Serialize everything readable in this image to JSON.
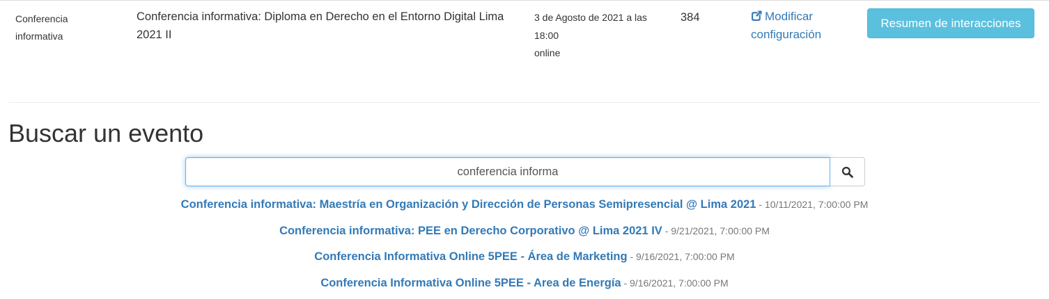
{
  "event_row": {
    "type": "Conferencia informativa",
    "name": "Conferencia informativa: Diploma en Derecho en el Entorno Digital Lima 2021 II",
    "date_line": "3 de Agosto de 2021 a las 18:00",
    "modality": "online",
    "count": "384",
    "config_link": "Modificar configuración",
    "summary_button": "Resumen de interacciones"
  },
  "search": {
    "title": "Buscar un evento",
    "query": "conferencia informa"
  },
  "results": [
    {
      "name": "Conferencia informativa: Maestría en Organización y Dirección de Personas Semipresencial @ Lima 2021",
      "date": " - 10/11/2021, 7:00:00 PM"
    },
    {
      "name": "Conferencia informativa: PEE en Derecho Corporativo @ Lima 2021 IV",
      "date": " - 9/21/2021, 7:00:00 PM"
    },
    {
      "name": "Conferencia Informativa Online 5PEE - Área de Marketing",
      "date": " - 9/16/2021, 7:00:00 PM"
    },
    {
      "name": "Conferencia Informativa Online 5PEE - Area de Energía",
      "date": " - 9/16/2021, 7:00:00 PM"
    }
  ],
  "icons": {
    "config": "external-link-icon",
    "search": "search-icon"
  },
  "colors": {
    "link": "#337ab7",
    "info_button": "#5bc0de",
    "input_focus": "#66afe9"
  }
}
